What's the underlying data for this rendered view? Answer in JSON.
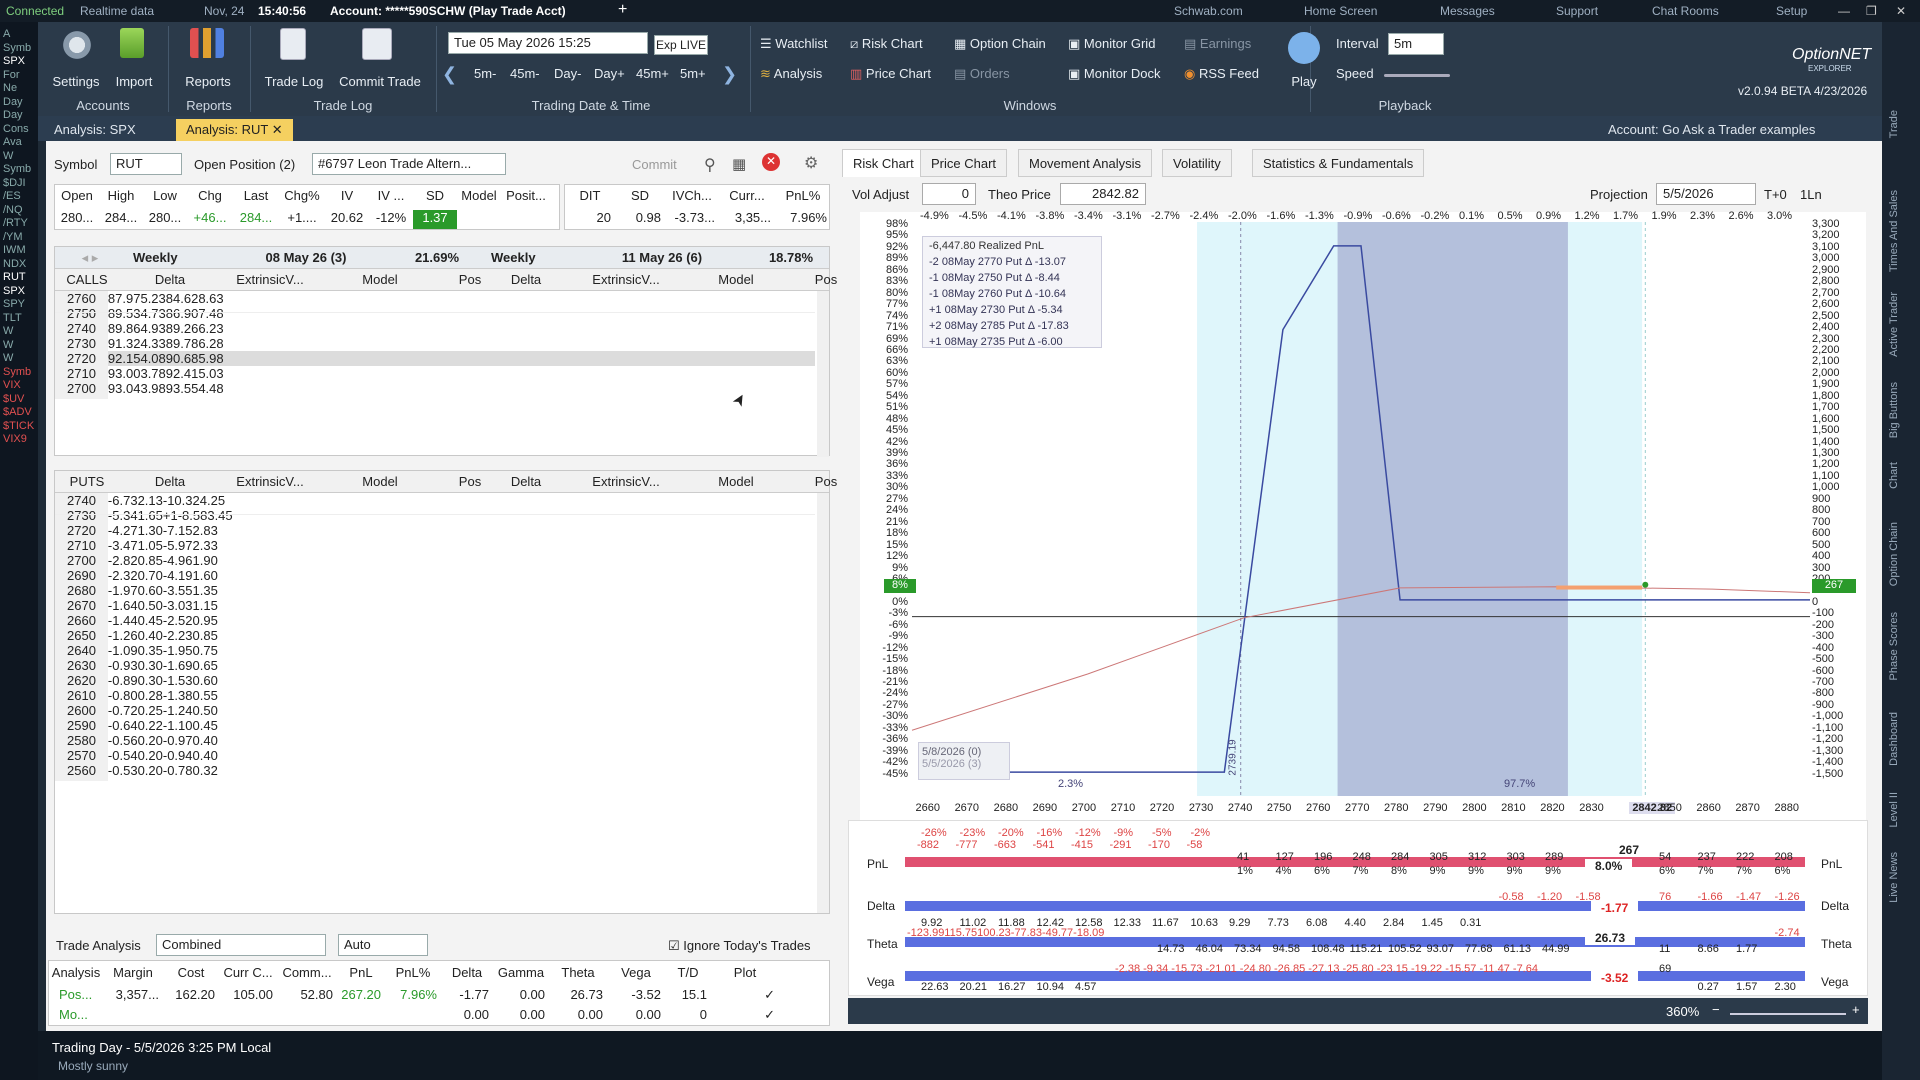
{
  "status": {
    "connected": "Connected",
    "realtime": "Realtime data",
    "date": "Nov, 24",
    "time": "15:40:56",
    "account": "Account: *****590SCHW (Play Trade Acct)",
    "links": [
      "Schwab.com",
      "Home Screen",
      "Messages",
      "Support",
      "Chat Rooms",
      "Setup"
    ]
  },
  "ribbon": {
    "settings": "Settings",
    "import": "Import",
    "accounts": "Accounts",
    "reports": "Reports",
    "reports_grp": "Reports",
    "tradelog": "Trade Log",
    "commit": "Commit Trade",
    "tradelog_grp": "Trade Log",
    "datetime": "Tue 05 May 2026 15:25",
    "exp_live": "Exp LIVE",
    "steps": [
      "5m-",
      "45m-",
      "Day-",
      "Day+",
      "45m+",
      "5m+"
    ],
    "datetime_grp": "Trading Date & Time",
    "watchlist": "Watchlist",
    "riskchart": "Risk Chart",
    "optionchain": "Option Chain",
    "monitorgrid": "Monitor Grid",
    "earnings": "Earnings",
    "analysis": "Analysis",
    "pricechart": "Price Chart",
    "orders": "Orders",
    "monitordock": "Monitor Dock",
    "rssfeed": "RSS Feed",
    "windows_grp": "Windows",
    "play": "Play",
    "interval_lbl": "Interval",
    "interval": "5m",
    "speed": "Speed",
    "playback_grp": "Playback",
    "brand": "OptionNET",
    "brand2": "EXPLORER",
    "version": "v2.0.94 BETA 4/23/2026"
  },
  "tabs": {
    "t1": "Analysis: SPX",
    "t2": "Analysis: RUT",
    "account": "Account: Go Ask a Trader examples"
  },
  "symbolbar": {
    "symbol_lbl": "Symbol",
    "symbol": "RUT",
    "open_lbl": "Open Position (2)",
    "trade": "#6797 Leon Trade Altern...",
    "commit": "Commit"
  },
  "quote": {
    "headers": [
      "Open",
      "High",
      "Low",
      "Chg",
      "Last",
      "Chg%",
      "IV",
      "IV ...",
      "SD",
      "Model",
      "Posit..."
    ],
    "values": [
      "280...",
      "284...",
      "280...",
      "+46...",
      "284...",
      "+1....",
      "20.62",
      "-12%",
      "1.37",
      "",
      ""
    ],
    "headers2": [
      "DIT",
      "SD",
      "IVCh...",
      "Curr...",
      "PnL%"
    ],
    "values2": [
      "20",
      "0.98",
      "-3.73...",
      "3,35...",
      "7.96%"
    ]
  },
  "chain": {
    "w1": "Weekly",
    "d1": "08 May 26 (3)",
    "p1": "21.69%",
    "w2": "Weekly",
    "d2": "11 May 26 (6)",
    "p2": "18.78%",
    "cols": [
      "Delta",
      "ExtrinsicV...",
      "Model",
      "Pos"
    ],
    "calls_lbl": "CALLS",
    "puts_lbl": "PUTS",
    "calls": [
      [
        "2760",
        "87.97",
        "5.23",
        "84.62",
        "8.63"
      ],
      [
        "2750",
        "89.53",
        "4.73",
        "86.90",
        "7.48"
      ],
      [
        "2740",
        "89.86",
        "4.93",
        "89.26",
        "6.23"
      ],
      [
        "2730",
        "91.32",
        "4.33",
        "89.78",
        "6.28"
      ],
      [
        "2720",
        "92.15",
        "4.08",
        "90.68",
        "5.98"
      ],
      [
        "2710",
        "93.00",
        "3.78",
        "92.41",
        "5.03"
      ],
      [
        "2700",
        "93.04",
        "3.98",
        "93.55",
        "4.48"
      ]
    ],
    "puts": [
      [
        "2740",
        "-6.73",
        "2.13",
        "",
        "-10.32",
        "4.25"
      ],
      [
        "2730",
        "-5.34",
        "1.65",
        "+1",
        "-8.58",
        "3.45"
      ],
      [
        "2720",
        "-4.27",
        "1.30",
        "",
        "-7.15",
        "2.83"
      ],
      [
        "2710",
        "-3.47",
        "1.05",
        "",
        "-5.97",
        "2.33"
      ],
      [
        "2700",
        "-2.82",
        "0.85",
        "",
        "-4.96",
        "1.90"
      ],
      [
        "2690",
        "-2.32",
        "0.70",
        "",
        "-4.19",
        "1.60"
      ],
      [
        "2680",
        "-1.97",
        "0.60",
        "",
        "-3.55",
        "1.35"
      ],
      [
        "2670",
        "-1.64",
        "0.50",
        "",
        "-3.03",
        "1.15"
      ],
      [
        "2660",
        "-1.44",
        "0.45",
        "",
        "-2.52",
        "0.95"
      ],
      [
        "2650",
        "-1.26",
        "0.40",
        "",
        "-2.23",
        "0.85"
      ],
      [
        "2640",
        "-1.09",
        "0.35",
        "",
        "-1.95",
        "0.75"
      ],
      [
        "2630",
        "-0.93",
        "0.30",
        "",
        "-1.69",
        "0.65"
      ],
      [
        "2620",
        "-0.89",
        "0.30",
        "",
        "-1.53",
        "0.60"
      ],
      [
        "2610",
        "-0.80",
        "0.28",
        "",
        "-1.38",
        "0.55"
      ],
      [
        "2600",
        "-0.72",
        "0.25",
        "",
        "-1.24",
        "0.50"
      ],
      [
        "2590",
        "-0.64",
        "0.22",
        "",
        "-1.10",
        "0.45"
      ],
      [
        "2580",
        "-0.56",
        "0.20",
        "",
        "-0.97",
        "0.40"
      ],
      [
        "2570",
        "-0.54",
        "0.20",
        "",
        "-0.94",
        "0.40"
      ],
      [
        "2560",
        "-0.53",
        "0.20",
        "",
        "-0.78",
        "0.32"
      ]
    ]
  },
  "tradeanalysis": {
    "lbl": "Trade Analysis",
    "mode": "Combined",
    "auto": "Auto",
    "ignore": "Ignore Today's Trades",
    "cols": [
      "Analysis",
      "Margin",
      "Cost",
      "Curr C...",
      "Comm...",
      "PnL",
      "PnL%",
      "Delta",
      "Gamma",
      "Theta",
      "Vega",
      "T/D",
      "Plot"
    ],
    "row1": [
      "Pos...",
      "3,357...",
      "162.20",
      "105.00",
      "52.80",
      "267.20",
      "7.96%",
      "-1.77",
      "0.00",
      "26.73",
      "-3.52",
      "15.1",
      "✓"
    ],
    "row2": [
      "Mo...",
      "",
      "",
      "",
      "",
      "",
      "",
      "0.00",
      "0.00",
      "0.00",
      "0.00",
      "0",
      "✓"
    ]
  },
  "risk": {
    "tabs": [
      "Risk Chart",
      "Price Chart",
      "Movement Analysis",
      "Volatility",
      "Statistics & Fundamentals"
    ],
    "voladj_lbl": "Vol Adjust",
    "voladj": "0",
    "theo_lbl": "Theo Price",
    "theo": "2842.82",
    "proj_lbl": "Projection",
    "proj": "5/5/2026",
    "t0": "T+0",
    "oneln": "1Ln",
    "toppct": [
      "-4.9%",
      "-4.5%",
      "-4.1%",
      "-3.8%",
      "-3.4%",
      "-3.1%",
      "-2.7%",
      "-2.4%",
      "-2.0%",
      "-1.6%",
      "-1.3%",
      "-0.9%",
      "-0.6%",
      "-0.2%",
      "0.1%",
      "0.5%",
      "0.9%",
      "1.2%",
      "1.7%",
      "1.9%",
      "2.3%",
      "2.6%",
      "3.0%"
    ],
    "leftpct": [
      "98%",
      "95%",
      "92%",
      "89%",
      "86%",
      "83%",
      "80%",
      "77%",
      "74%",
      "71%",
      "69%",
      "66%",
      "63%",
      "60%",
      "57%",
      "54%",
      "51%",
      "48%",
      "45%",
      "42%",
      "39%",
      "36%",
      "33%",
      "30%",
      "27%",
      "24%",
      "21%",
      "18%",
      "15%",
      "12%",
      "9%",
      "6%",
      "3%",
      "0%",
      "-3%",
      "-6%",
      "-9%",
      "-12%",
      "-15%",
      "-18%",
      "-21%",
      "-24%",
      "-27%",
      "-30%",
      "-33%",
      "-36%",
      "-39%",
      "-42%",
      "-45%"
    ],
    "rightval": [
      "3,300",
      "3,200",
      "3,100",
      "3,000",
      "2,900",
      "2,800",
      "2,700",
      "2,600",
      "2,500",
      "2,400",
      "2,300",
      "2,200",
      "2,100",
      "2,000",
      "1,900",
      "1,800",
      "1,700",
      "1,600",
      "1,500",
      "1,400",
      "1,300",
      "1,200",
      "1,100",
      "1,000",
      "900",
      "800",
      "700",
      "600",
      "500",
      "400",
      "300",
      "200",
      "100",
      "0",
      "-100",
      "-200",
      "-300",
      "-400",
      "-500",
      "-600",
      "-700",
      "-800",
      "-900",
      "-1,000",
      "-1,100",
      "-1,200",
      "-1,300",
      "-1,400",
      "-1,500"
    ],
    "xticks": [
      "2660",
      "2670",
      "2680",
      "2690",
      "2700",
      "2710",
      "2720",
      "2730",
      "2740",
      "2750",
      "2760",
      "2770",
      "2780",
      "2790",
      "2800",
      "2810",
      "2820",
      "2830",
      "2842.82",
      "2850",
      "2860",
      "2870",
      "2880"
    ],
    "legend": [
      "-6,447.80 Realized PnL",
      "-2 08May 2770 Put Δ  -13.07",
      "-1 08May 2750 Put Δ  -8.44",
      "-1 08May 2760 Put Δ  -10.64",
      "+1 08May 2730 Put Δ  -5.34",
      "+2 08May 2785 Put Δ  -17.83",
      "+1 08May 2735 Put Δ  -6.00"
    ],
    "date1": "5/8/2026 (0)",
    "date2": "5/5/2026 (3)",
    "pct_left": "2.3%",
    "pct_right": "97.7%",
    "vline": "2739.19",
    "leftbadge": "8%",
    "rightbadge": "267",
    "zoom": "360%"
  },
  "greeks": {
    "labels": [
      "PnL",
      "Delta",
      "Theta",
      "Vega"
    ],
    "cur": [
      "267",
      "8.0%",
      "-1.77",
      "26.73",
      "-3.52"
    ],
    "pnl_neg": [
      "-26%",
      "-23%",
      "-20%",
      "-16%",
      "-12%",
      "-9%",
      "-5%",
      "-2%"
    ],
    "pnl_negv": [
      "-882",
      "-777",
      "-663",
      "-541",
      "-415",
      "-291",
      "-170",
      "-58"
    ],
    "pnl_pos": [
      "41",
      "127",
      "196",
      "248",
      "284",
      "305",
      "312",
      "303",
      "289"
    ],
    "pnl_posp": [
      "1%",
      "4%",
      "6%",
      "7%",
      "8%",
      "9%",
      "9%",
      "9%",
      "9%"
    ],
    "pnl_r": [
      "54",
      "237",
      "222",
      "208"
    ],
    "pnl_rp": [
      "6%",
      "7%",
      "7%",
      "6%"
    ],
    "delta": [
      "9.92",
      "11.02",
      "11.88",
      "12.42",
      "12.58",
      "12.33",
      "11.67",
      "10.63",
      "9.29",
      "7.73",
      "6.08",
      "4.40",
      "2.84",
      "1.45",
      "0.31",
      "-0.58",
      "-1.20",
      "-1.58"
    ],
    "delta_r": [
      "76",
      "-1.66",
      "-1.47",
      "-1.26"
    ],
    "theta_neg": "-123.99115.75100.23-77.83-49.77-18.09",
    "theta": [
      "14.73",
      "46.04",
      "73.34",
      "94.58",
      "108.48",
      "115.21",
      "105.52",
      "93.07",
      "77.68",
      "61.13",
      "44.99"
    ],
    "theta_r": [
      "11",
      "8.66",
      "1.77",
      "-2.74"
    ],
    "vega": [
      "22.63",
      "20.21",
      "16.27",
      "10.94",
      "4.57"
    ],
    "vega_neg": "-2.38 -9.34 -15.73 -21.01 -24.80 -26.85 -27.13 -25.80 -23.15 -19.22 -15.57 -11.47 -7.64",
    "vega_r": [
      "69",
      "0.27",
      "1.57",
      "2.30"
    ]
  },
  "footer": {
    "tradingday": "Trading Day - 5/5/2026 3:25 PM Local",
    "weather": "Mostly sunny"
  },
  "leftstrip": [
    "A",
    "Symb",
    "SPX",
    "For",
    "Ne",
    "Day",
    "Day",
    "Cons",
    "Ava",
    "W",
    "Symb",
    "$DJI",
    "/ES",
    "/NQ",
    "/RTY",
    "/YM",
    "IWM",
    "NDX",
    "RUT",
    "SPX",
    "SPY",
    "TLT",
    "W",
    "W",
    "W",
    "Symb",
    "VIX",
    "$UV",
    "$ADV",
    "$TICK",
    "VIX9"
  ],
  "rightstrip": [
    "Trade",
    "Times And Sales",
    "Active Trader",
    "Big Buttons",
    "Chart",
    "Option Chain",
    "Phase Scores",
    "Dashboard",
    "Level II",
    "Live News"
  ]
}
